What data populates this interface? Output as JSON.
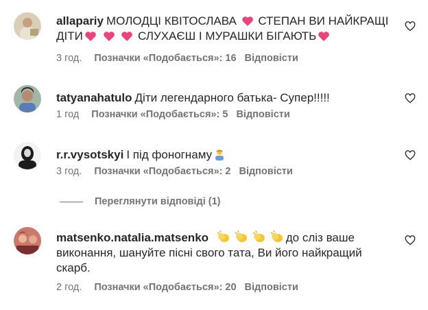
{
  "comments": [
    {
      "username": "allapariy",
      "text_parts": [
        "МОЛОДЦІ КВІТОСЛАВА ",
        " СТЕПАН ВИ НАЙКРАЩІ ДІТИ",
        " ",
        " ",
        " СЛУХАЄШ І МУРАШКИ БІГАЮТЬ"
      ],
      "time": "3 год.",
      "likes": "Позначки «Подобається»: 16",
      "reply": "Відповісти"
    },
    {
      "username": "tatyanahatulo",
      "text": "Діти легендарного батька- Супер!!!!!",
      "time": "1 год",
      "likes": "Позначки «Подобається»: 5",
      "reply": "Відповісти"
    },
    {
      "username": "r.r.vysotskyi",
      "text": "І під фоногнаму",
      "time": "3 год.",
      "likes": "Позначки «Подобається»: 2",
      "reply": "Відповісти"
    },
    {
      "username": "matsenko.natalia.matsenko",
      "text_parts": [
        "до сліз ваше виконання, шануйте пісні свого тата, Ви його найкращий скарб."
      ],
      "time": "2 год.",
      "likes": "Позначки «Подобається»: 20",
      "reply": "Відповісти"
    }
  ],
  "view_replies": "Переглянути відповіді (1)",
  "icons": {
    "like": "heart-outline-icon",
    "emoji_heart": "pink-heart-emoji",
    "emoji_clap": "clapping-hands-emoji",
    "emoji_shrug": "person-shrugging-emoji"
  },
  "colors": {
    "text": "#262626",
    "secondary": "#737373",
    "pink_heart": "#e8457a"
  }
}
